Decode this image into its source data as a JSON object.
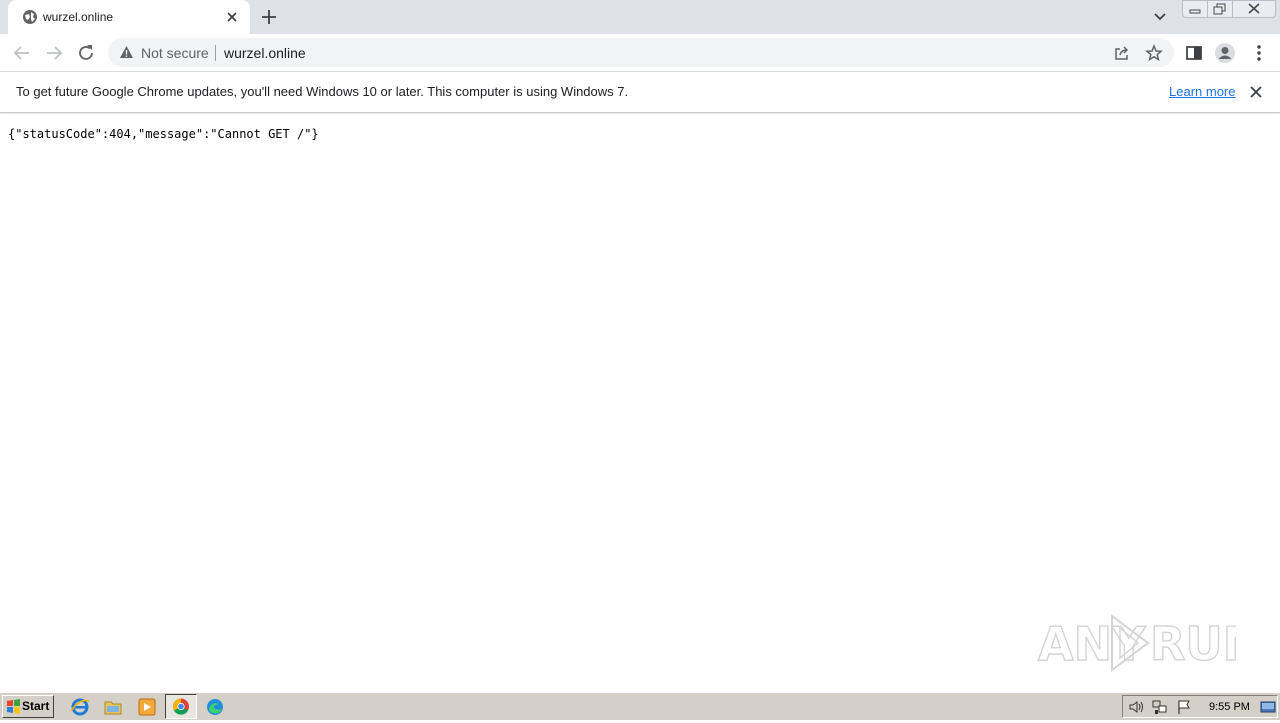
{
  "colors": {
    "tabstrip": "#dee1e6",
    "link": "#1a73e8",
    "taskbar": "#d4d0c8"
  },
  "tab": {
    "title": "wurzel.online",
    "favicon": "globe-icon"
  },
  "toolbar": {
    "security_label": "Not secure",
    "url": "wurzel.online"
  },
  "infobar": {
    "message": "To get future Google Chrome updates, you'll need Windows 10 or later. This computer is using Windows 7.",
    "link_label": "Learn more"
  },
  "page": {
    "body_text": "{\"statusCode\":404,\"message\":\"Cannot GET /\"}"
  },
  "watermark": {
    "text_left": "ANY",
    "text_right": "RUN"
  },
  "taskbar": {
    "start_label": "Start",
    "clock": "9:55 PM",
    "apps": [
      "internet-explorer-icon",
      "folder-icon",
      "media-player-icon",
      "chrome-icon",
      "edge-icon"
    ]
  }
}
